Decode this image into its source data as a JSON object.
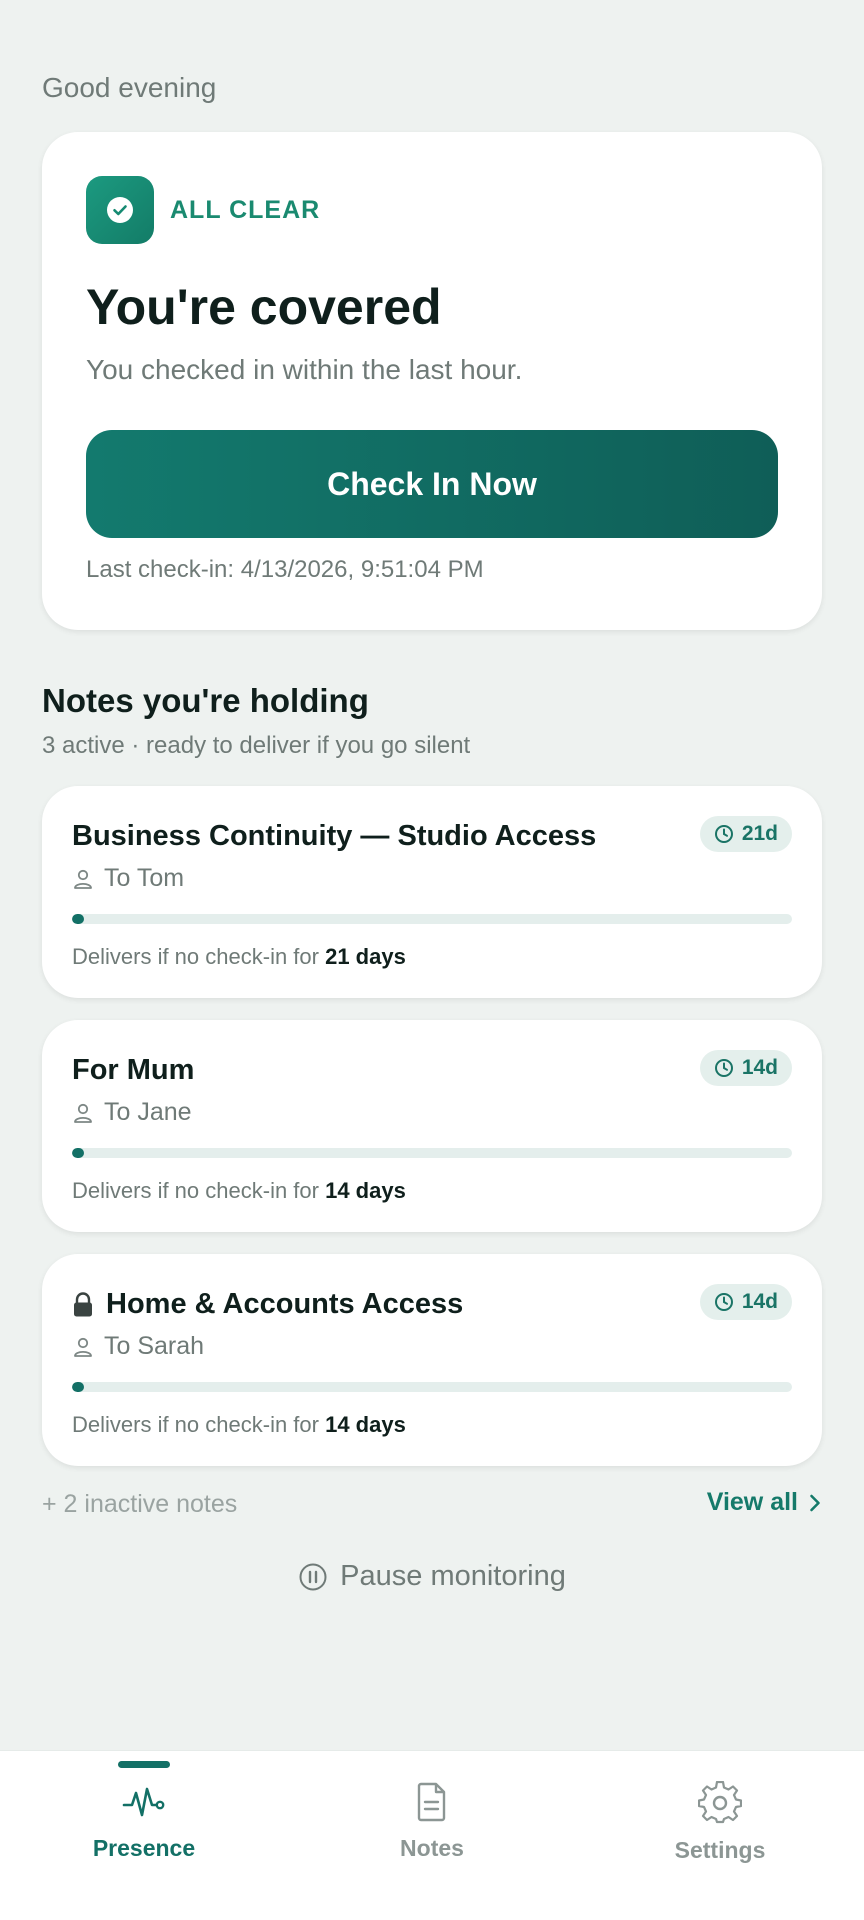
{
  "greeting": "Good evening",
  "status": {
    "label": "ALL CLEAR",
    "title": "You're covered",
    "subtitle": "You checked in within the last hour.",
    "button_label": "Check In Now",
    "last_checkin": "Last check-in: 4/13/2026, 9:51:04 PM"
  },
  "notes_section": {
    "title": "Notes you're holding",
    "subtitle": "3 active · ready to deliver if you go silent"
  },
  "notes": [
    {
      "title": "Business Continuity — Studio Access",
      "recipient": "To Tom",
      "badge": "21d",
      "deliver_prefix": "Delivers if no check-in for ",
      "deliver_days": "21 days",
      "locked": false,
      "progress": 0.01
    },
    {
      "title": "For Mum",
      "recipient": "To Jane",
      "badge": "14d",
      "deliver_prefix": "Delivers if no check-in for ",
      "deliver_days": "14 days",
      "locked": false,
      "progress": 0.01
    },
    {
      "title": "Home & Accounts Access",
      "recipient": "To Sarah",
      "badge": "14d",
      "deliver_prefix": "Delivers if no check-in for ",
      "deliver_days": "14 days",
      "locked": true,
      "progress": 0.01
    }
  ],
  "inactive_text": "+ 2 inactive notes",
  "view_all_label": "View all",
  "pause_label": "Pause monitoring",
  "nav": {
    "presence": "Presence",
    "notes": "Notes",
    "settings": "Settings",
    "active": "presence"
  },
  "colors": {
    "accent": "#137066",
    "accent_text": "#1a8a70",
    "background": "#eef2f0",
    "muted": "#6f7a77"
  },
  "icons": {
    "status": "check-circle-icon",
    "badge": "clock-icon",
    "recipient": "person-icon",
    "lock": "lock-icon",
    "view_all": "chevron-right-icon",
    "pause": "pause-circle-icon",
    "presence": "pulse-icon",
    "notes": "document-icon",
    "settings": "gear-icon"
  }
}
